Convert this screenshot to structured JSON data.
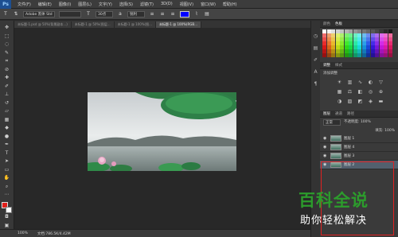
{
  "app": {
    "logo": "Ps"
  },
  "menu": [
    "文件(F)",
    "编辑(E)",
    "图像(I)",
    "图层(L)",
    "文字(Y)",
    "选择(S)",
    "滤镜(T)",
    "3D(D)",
    "视图(V)",
    "窗口(W)",
    "帮助(H)"
  ],
  "options": {
    "font_family": "Adobe 黑体 Std",
    "font_size": "30点",
    "aa_mode": "锐利",
    "text_color": "#0000ff"
  },
  "tabs": [
    {
      "label": "未标题-1.psd @ 50%(背景副本...)",
      "active": false
    },
    {
      "label": "未标题-1 @ 50%(图层...",
      "active": false
    },
    {
      "label": "未标题-1 @ 100%(图...",
      "active": false
    },
    {
      "label": "未标题-1 @ 100%(RGB...",
      "active": false
    }
  ],
  "status": {
    "zoom": "100%",
    "doc_size": "文档:786.5K/4.42M"
  },
  "panels": {
    "color_tabs": [
      "颜色",
      "色板"
    ],
    "adj_tabs": [
      "调整",
      "样式"
    ],
    "adj_label": "添加调整",
    "layers_tabs": [
      "图层",
      "通道",
      "路径"
    ],
    "blend_mode": "正常",
    "opacity_label": "不透明度: 100%",
    "fill_label": "填充: 100%",
    "layers": [
      {
        "name": "图层 1",
        "selected": false
      },
      {
        "name": "图层 4",
        "selected": false
      },
      {
        "name": "图层 3",
        "selected": false
      },
      {
        "name": "图层 2",
        "selected": true
      }
    ]
  },
  "watermark": {
    "line1": "百科全说",
    "line2": "助你轻松解决"
  }
}
